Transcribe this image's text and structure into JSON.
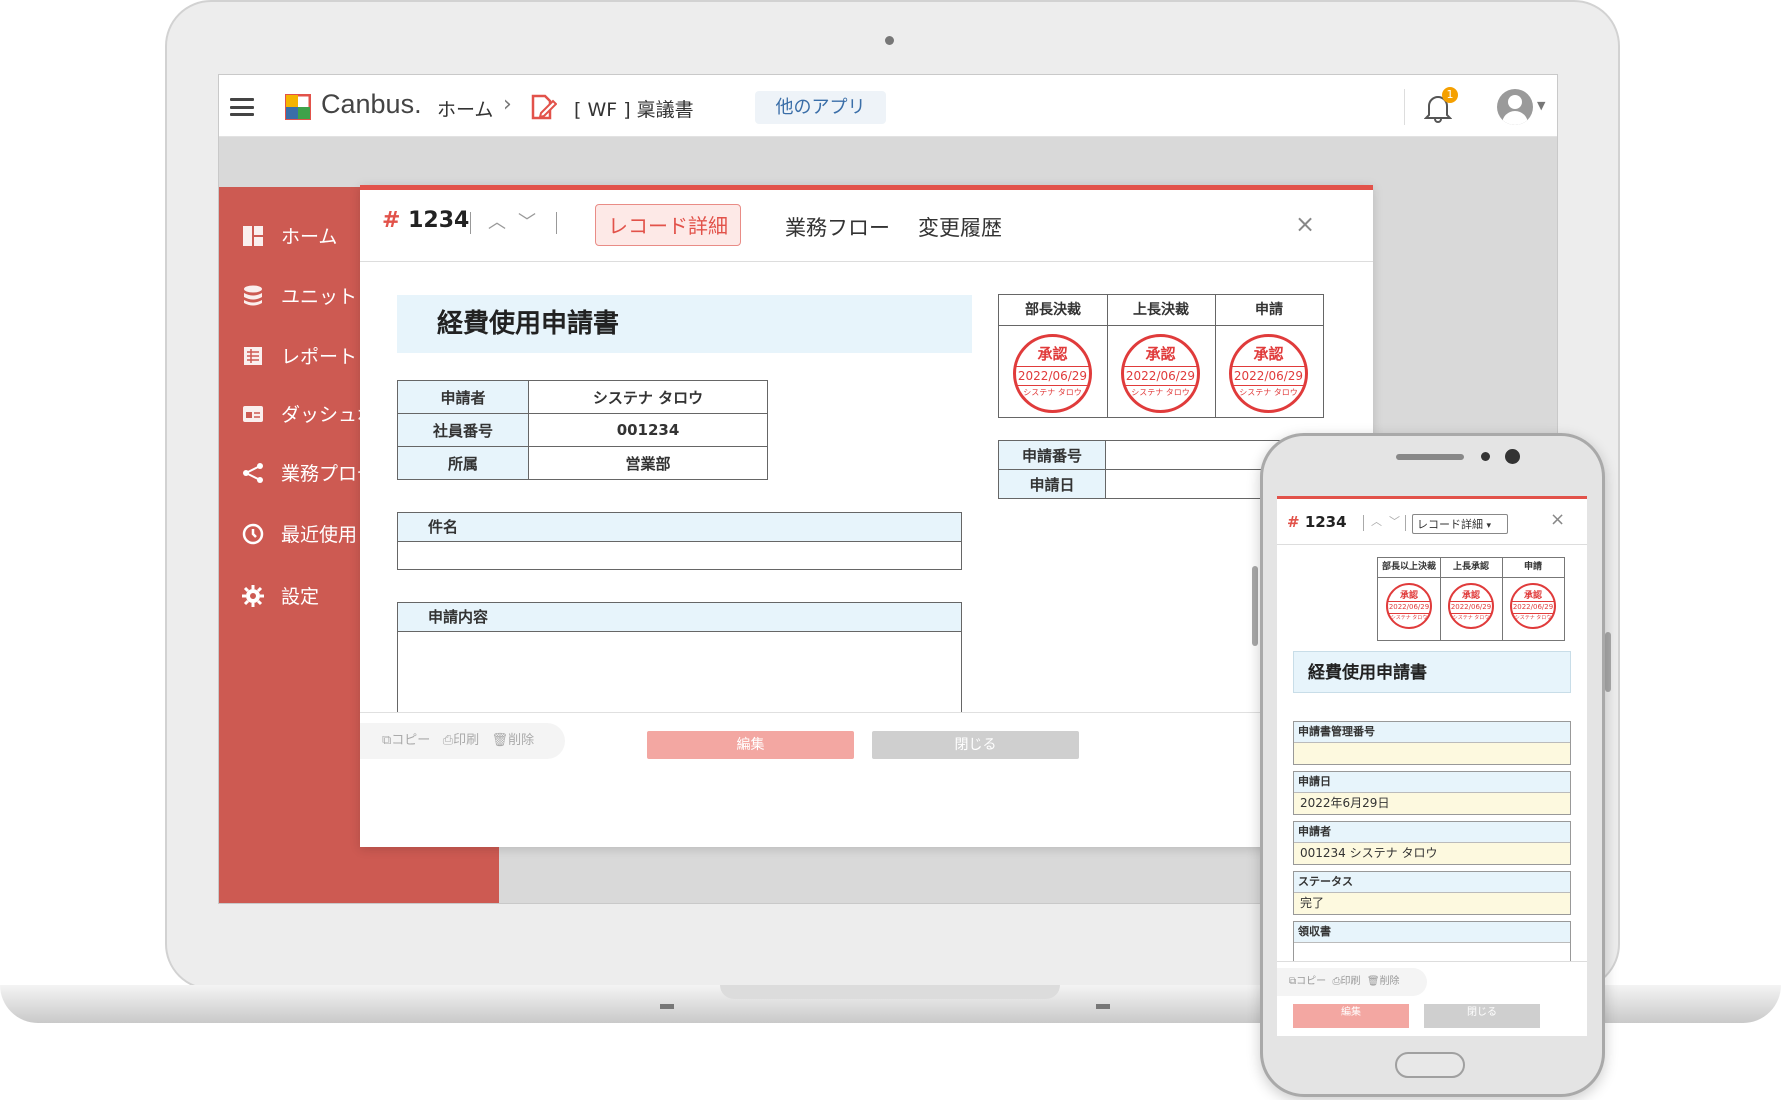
{
  "header": {
    "logo_text": "Canbus.",
    "breadcrumb_home": "ホーム",
    "breadcrumb_sep": "›",
    "app_name": "[ WF ] 稟議書",
    "other_apps_label": "他のアプリ",
    "notification_count": "1"
  },
  "sidebar": {
    "items": [
      {
        "label": "ホーム",
        "icon": "dashboard-icon"
      },
      {
        "label": "ユニット",
        "icon": "database-icon"
      },
      {
        "label": "レポート",
        "icon": "report-icon"
      },
      {
        "label": "ダッシュボード",
        "icon": "dashboard-card-icon"
      },
      {
        "label": "業務プロセス",
        "icon": "flow-icon"
      },
      {
        "label": "最近使用",
        "icon": "clock-icon"
      },
      {
        "label": "設定",
        "icon": "gear-icon"
      }
    ]
  },
  "record": {
    "hash": "#",
    "number": "1234",
    "tabs": {
      "detail": "レコード詳細",
      "flow": "業務フロー",
      "history": "変更履歴"
    },
    "close": "×",
    "title": "経費使用申請書",
    "info": [
      {
        "label": "申請者",
        "value": "システナ タロウ"
      },
      {
        "label": "社員番号",
        "value": "001234"
      },
      {
        "label": "所属",
        "value": "営業部"
      }
    ],
    "subject_label": "件名",
    "content_label": "申請内容",
    "approvals": [
      {
        "title": "部長決裁",
        "stamp": "承認",
        "date": "2022/06/29",
        "name": "システナ タロウ"
      },
      {
        "title": "上長決裁",
        "stamp": "承認",
        "date": "2022/06/29",
        "name": "システナ タロウ"
      },
      {
        "title": "申請",
        "stamp": "承認",
        "date": "2022/06/29",
        "name": "システナ タロウ"
      }
    ],
    "nums": {
      "app_no_label": "申請番号",
      "app_date_label": "申請日"
    },
    "footer": {
      "copy": "コピー",
      "print": "印刷",
      "delete": "削除",
      "edit": "編集",
      "close": "閉じる"
    }
  },
  "phone": {
    "hash": "#",
    "number": "1234",
    "select_value": "レコード詳細",
    "close": "×",
    "approvals": [
      {
        "title": "部長以上決裁",
        "stamp": "承認",
        "date": "2022/06/29",
        "name": "システナ タロウ"
      },
      {
        "title": "上長承認",
        "stamp": "承認",
        "date": "2022/06/29",
        "name": "システナ タロウ"
      },
      {
        "title": "申請",
        "stamp": "承認",
        "date": "2022/06/29",
        "name": "システナ タロウ"
      }
    ],
    "title": "経費使用申請書",
    "fields": [
      {
        "label": "申請書管理番号",
        "value": ""
      },
      {
        "label": "申請日",
        "value": "2022年6月29日"
      },
      {
        "label": "申請者",
        "value": "001234 システナ タロウ"
      },
      {
        "label": "ステータス",
        "value": "完了"
      },
      {
        "label": "領収書",
        "value": ""
      }
    ],
    "footer": {
      "copy": "コピー",
      "print": "印刷",
      "delete": "削除",
      "edit": "編集",
      "close": "閉じる"
    }
  },
  "colors": {
    "accent": "#e2524a",
    "sidebar": "#cd5a52",
    "label_bg": "#e7f4fb",
    "value_bg": "#fdf9df"
  }
}
